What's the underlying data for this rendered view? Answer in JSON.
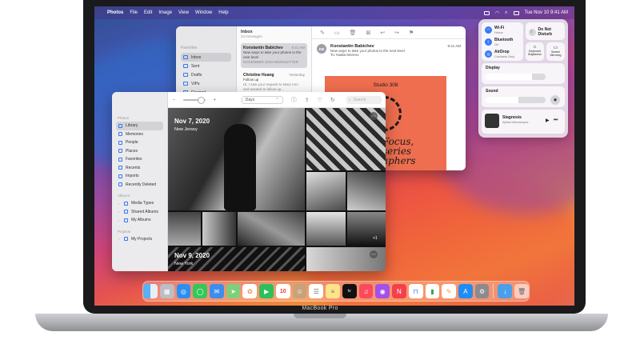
{
  "device": {
    "model_label": "MacBook Pro"
  },
  "menubar": {
    "app": "Photos",
    "menus": [
      "File",
      "Edit",
      "Image",
      "View",
      "Window",
      "Help"
    ],
    "clock": "Tue Nov 10  9:41 AM"
  },
  "mail": {
    "sidebar": {
      "section": "Favorites",
      "items": [
        "Inbox",
        "Sent",
        "Drafts",
        "VIPs",
        "Flagged"
      ],
      "selected": "Inbox"
    },
    "list": {
      "title": "Inbox",
      "subtitle": "24 messages",
      "messages": [
        {
          "from": "Konstantin Babichev",
          "time": "9:41 AM",
          "line1": "New ways to take your photos to the next level",
          "line2": "NOVEMBER 2020 NEWSLETTER"
        },
        {
          "from": "Christine Huang",
          "time": "Yesterday",
          "line1": "Follow up",
          "line2": "Hi, I saw your request to Mary Ann and wanted to follow up..."
        }
      ]
    },
    "reader": {
      "avatar": "KB",
      "from": "Konstantin Babichev",
      "time": "9:41 AM",
      "subject": "New ways to take your photos to the next level",
      "to_label": "To:",
      "to": "Nadia Moreno",
      "poster_title": "Studio 308",
      "poster_text_1": "Focus,",
      "poster_text_2": "series",
      "poster_text_3": "aphers"
    }
  },
  "control_center": {
    "wifi": {
      "label": "Wi-Fi",
      "sub": "Home"
    },
    "bluetooth": {
      "label": "Bluetooth",
      "sub": "On"
    },
    "airdrop": {
      "label": "AirDrop",
      "sub": "Contacts Only"
    },
    "dnd": {
      "label": "Do Not Disturb"
    },
    "keyboard": {
      "label": "Keyboard Brightness"
    },
    "mirroring": {
      "label": "Screen Mirroring"
    },
    "display": {
      "label": "Display",
      "level": 0.78
    },
    "sound": {
      "label": "Sound",
      "level": 0.55
    },
    "now_playing": {
      "title": "Stagnosis",
      "artist": "Alpha Microscopic"
    }
  },
  "photos": {
    "sidebar": {
      "section_photos": "Photos",
      "items": [
        "Library",
        "Memories",
        "People",
        "Places",
        "Favorites",
        "Recents",
        "Imports",
        "Recently Deleted"
      ],
      "selected": "Library",
      "section_albums": "Albums",
      "albums": [
        "Media Types",
        "Shared Albums",
        "My Albums"
      ],
      "section_projects": "Projects",
      "projects": [
        "My Projects"
      ]
    },
    "toolbar": {
      "view_select": "Days",
      "search_placeholder": "Search"
    },
    "days": [
      {
        "date": "Nov 7, 2020",
        "place": "New Jersey"
      },
      {
        "date": "Nov 9, 2020",
        "place": "New York"
      }
    ],
    "extra_badge": "+1"
  },
  "dock": {
    "apps": [
      "Finder",
      "Launchpad",
      "Safari",
      "Messages",
      "Mail",
      "Maps",
      "Photos",
      "FaceTime",
      "Calendar",
      "Contacts",
      "Reminders",
      "Notes",
      "Apple TV",
      "Music",
      "Podcasts",
      "News",
      "Keynote",
      "Numbers",
      "Pages",
      "App Store",
      "System Preferences",
      "Downloads",
      "Trash"
    ],
    "calendar_day": "10"
  },
  "colors": {
    "accent": "#3478f6",
    "poster": "#ee6e4f"
  }
}
